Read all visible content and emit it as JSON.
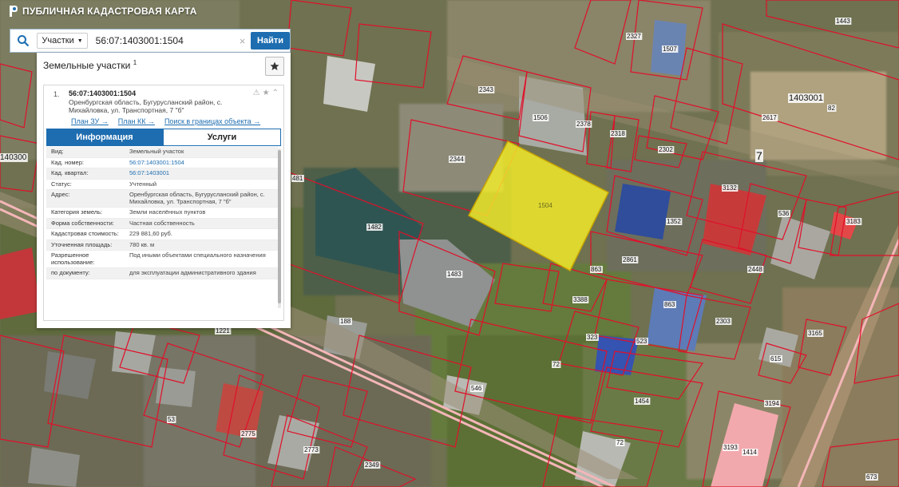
{
  "app": {
    "title": "ПУБЛИЧНАЯ КАДАСТРОВАЯ КАРТА"
  },
  "search": {
    "type_label": "Участки",
    "value": "56:07:1403001:1504",
    "button": "Найти"
  },
  "panel": {
    "title": "Земельные участки",
    "title_sup": "1",
    "item": {
      "number": "1.",
      "id": "56:07:1403001:1504",
      "address": "Оренбургская область, Бугурусланский район, с. Михайловка, ул. Транспортная, 7 \"б\""
    },
    "links": [
      "План ЗУ →",
      "План КК →",
      "Поиск в границах объекта →"
    ],
    "tabs": [
      {
        "label": "Информация",
        "active": true
      },
      {
        "label": "Услуги",
        "active": false
      }
    ],
    "rows": [
      {
        "k": "Вид:",
        "v": "Земельный участок"
      },
      {
        "k": "Кад. номер:",
        "v": "56:07:1403001:1504"
      },
      {
        "k": "Кад. квартал:",
        "v": "56:07:1403001"
      },
      {
        "k": "Статус:",
        "v": "Учтенный"
      },
      {
        "k": "Адрес:",
        "v": "Оренбургская область, Бугурусланский район, с. Михайловка, ул. Транспортная, 7 \"б\""
      },
      {
        "k": "Категория земель:",
        "v": "Земли населённых пунктов"
      },
      {
        "k": "Форма собственности:",
        "v": "Частная собственность"
      },
      {
        "k": "Кадастровая стоимость:",
        "v": "229 881,60 руб."
      },
      {
        "k": "Уточненная площадь:",
        "v": "780 кв. м"
      },
      {
        "k": "Разрешенное использование:",
        "v": "Под иными объектами специального назначения"
      },
      {
        "k": "по документу:",
        "v": "для эксплуатации административного здания"
      }
    ]
  },
  "map": {
    "labels": [
      "1403001",
      "82",
      "1443",
      "2327",
      "1507",
      "2343",
      "1506",
      "2378",
      "2318",
      "2302",
      "2344",
      "1504",
      "7",
      "3132",
      "1352",
      "536",
      "481",
      "1482",
      "1483",
      "2861",
      "2448",
      "863",
      "3388",
      "863",
      "2303",
      "188",
      "1221",
      "323",
      "523",
      "72",
      "546",
      "1454",
      "615",
      "3194",
      "3165",
      "53",
      "2775",
      "2773",
      "2349",
      "72",
      "3193",
      "1414",
      "673",
      "140300",
      "2617",
      "3183",
      "1573"
    ],
    "colors": {
      "selected": "#f5ee2a",
      "boundary": "#e0102a",
      "accent": "#1e6db0"
    }
  }
}
